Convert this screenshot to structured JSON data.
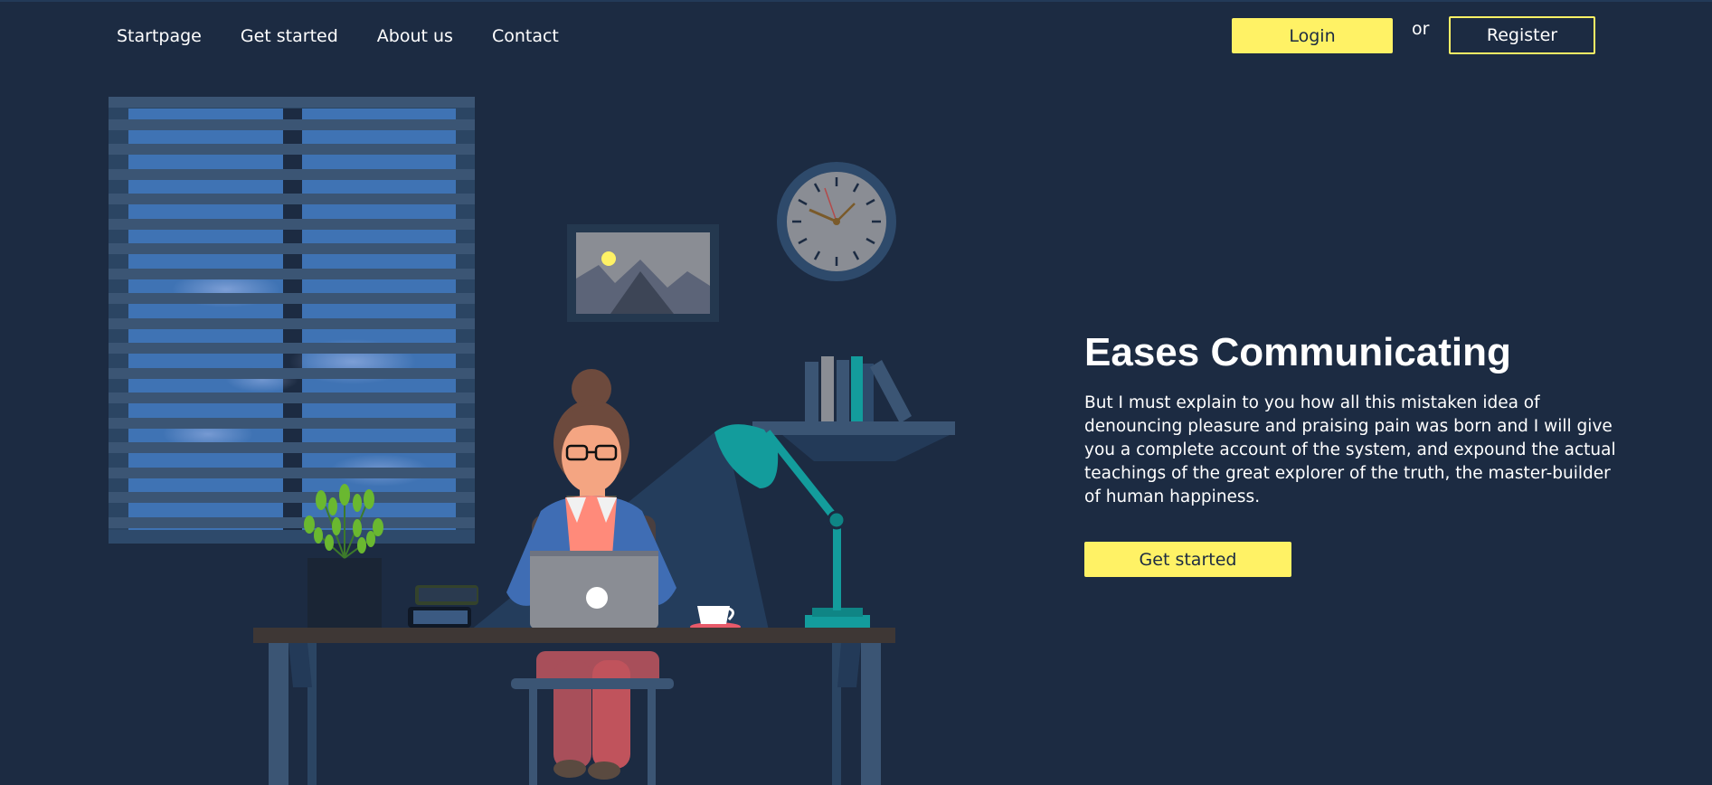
{
  "nav": {
    "links": [
      "Startpage",
      "Get started",
      "About us",
      "Contact"
    ],
    "login_label": "Login",
    "or_label": "or",
    "register_label": "Register"
  },
  "hero": {
    "title": "Eases Communicating",
    "text": "But I must explain to you how all this mistaken idea of denouncing pleasure and praising pain was born and I will give you a complete account of the system, and expound the actual teachings of the great explorer of the truth, the master-builder of human happiness.",
    "button_label": "Get started"
  },
  "colors": {
    "background": "#1c2b42",
    "accent": "#fff265",
    "window_blue": "#3f73b4",
    "lamp_teal": "#139c9c"
  }
}
